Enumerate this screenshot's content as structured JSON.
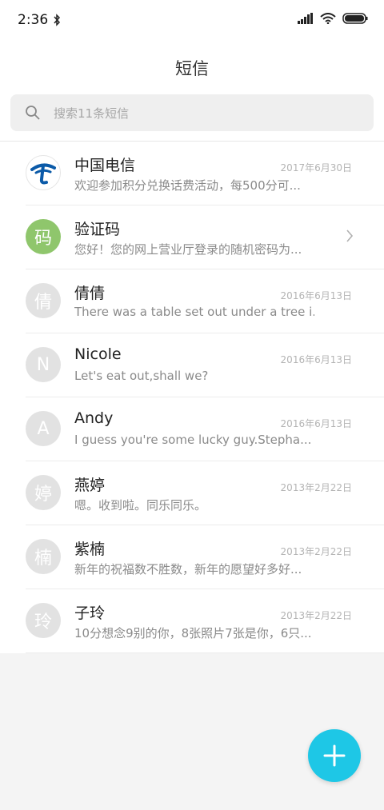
{
  "status_bar": {
    "time": "2:36"
  },
  "header": {
    "title": "短信"
  },
  "search": {
    "placeholder": "搜索11条短信"
  },
  "conversations": [
    {
      "name": "中国电信",
      "snippet": "欢迎参加积分兑换话费活动，每500分可...",
      "date": "2017年6月30日",
      "avatar": "china-telecom-logo"
    },
    {
      "name": "验证码",
      "snippet": "您好！您的网上营业厅登录的随机密码为...",
      "date": "",
      "avatar": "码"
    },
    {
      "name": "倩倩",
      "snippet": "There was a table set out under a tree i...",
      "date": "2016年6月13日",
      "avatar": "倩"
    },
    {
      "name": "Nicole",
      "snippet": "Let's eat out,shall we?",
      "date": "2016年6月13日",
      "avatar": "N"
    },
    {
      "name": "Andy",
      "snippet": "I guess you're some lucky guy.Stepha...",
      "date": "2016年6月13日",
      "avatar": "A"
    },
    {
      "name": "燕婷",
      "snippet": "嗯。收到啦。同乐同乐。",
      "date": "2013年2月22日",
      "avatar": "婷"
    },
    {
      "name": "紫楠",
      "snippet": "新年的祝福数不胜数，新年的愿望好多好...",
      "date": "2013年2月22日",
      "avatar": "楠"
    },
    {
      "name": "子玲",
      "snippet": "10分想念9别的你，8张照片7张是你，6只...",
      "date": "2013年2月22日",
      "avatar": "玲"
    }
  ],
  "fab": {
    "icon": "plus-icon"
  },
  "colors": {
    "accent": "#1ec7e6",
    "verify_avatar": "#8fc66c",
    "telecom_blue": "#0b5aa8"
  }
}
